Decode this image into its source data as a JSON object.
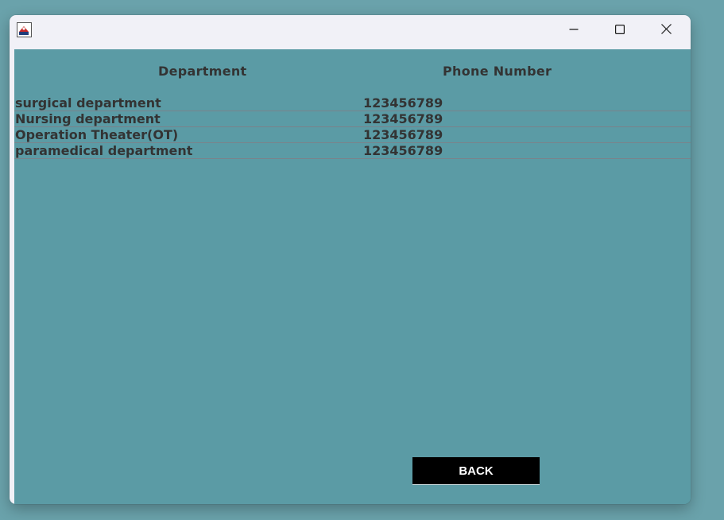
{
  "window": {
    "app_icon": "java-app-icon",
    "controls": {
      "minimize_icon": "minimize-icon",
      "maximize_icon": "maximize-icon",
      "close_icon": "close-icon"
    }
  },
  "table": {
    "columns": [
      "Department",
      "Phone Number"
    ],
    "rows": [
      {
        "department": "surgical department",
        "phone": "123456789"
      },
      {
        "department": "Nursing department",
        "phone": "123456789"
      },
      {
        "department": "Operation Theater(OT)",
        "phone": "123456789"
      },
      {
        "department": "paramedical department",
        "phone": "123456789"
      }
    ]
  },
  "actions": {
    "back_label": "BACK"
  },
  "colors": {
    "panel_background": "#5b9ba5",
    "desktop_background": "#6aa2ab",
    "titlebar": "#f1f1f7",
    "text": "#333333",
    "button_background": "#000000",
    "button_text": "#ffffff"
  }
}
